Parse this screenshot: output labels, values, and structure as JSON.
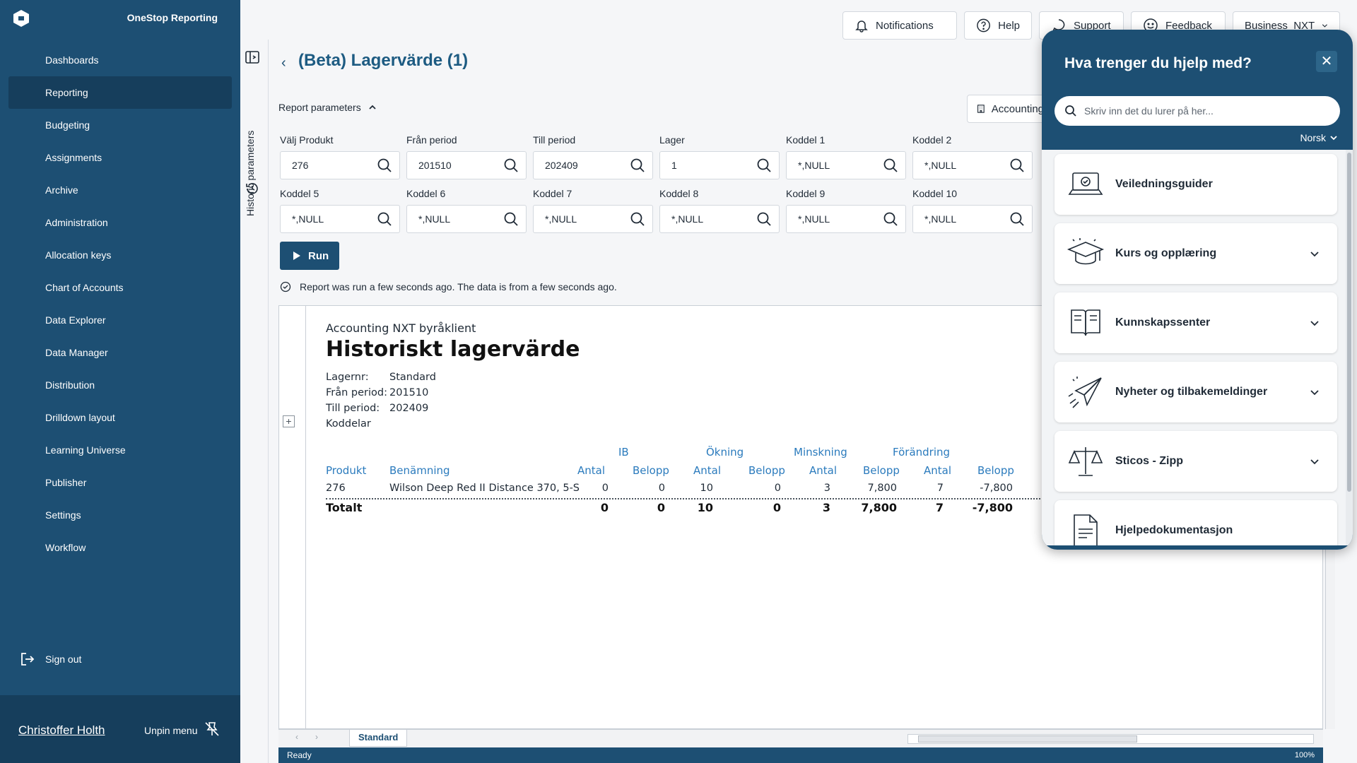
{
  "sidebar": {
    "brand": "OneStop Reporting",
    "items": [
      {
        "label": "Dashboards"
      },
      {
        "label": "Reporting"
      },
      {
        "label": "Budgeting"
      },
      {
        "label": "Assignments"
      },
      {
        "label": "Archive"
      },
      {
        "label": "Administration"
      },
      {
        "label": "Allocation keys"
      },
      {
        "label": "Chart of Accounts"
      },
      {
        "label": "Data Explorer"
      },
      {
        "label": "Data Manager"
      },
      {
        "label": "Distribution"
      },
      {
        "label": "Drilldown layout"
      },
      {
        "label": "Learning Universe"
      },
      {
        "label": "Publisher"
      },
      {
        "label": "Settings"
      },
      {
        "label": "Workflow"
      }
    ],
    "active_item": "Reporting",
    "sign_out": "Sign out",
    "user_name": "Christoffer Holth",
    "unpin_menu": "Unpin menu"
  },
  "side_panel": {
    "label": "Historic parameters"
  },
  "topbar": {
    "notifications": "Notifications",
    "help": "Help",
    "support": "Support",
    "feedback": "Feedback",
    "company": "Business_NXT"
  },
  "page": {
    "title": "(Beta) Lagervärde (1)",
    "report_parameters": "Report parameters",
    "accounting_button": "Accounting"
  },
  "params": [
    {
      "label": "Välj Produkt",
      "value": "276"
    },
    {
      "label": "Från period",
      "value": "201510"
    },
    {
      "label": "Till period",
      "value": "202409"
    },
    {
      "label": "Lager",
      "value": "1"
    },
    {
      "label": "Koddel 1",
      "value": "*,NULL"
    },
    {
      "label": "Koddel 2",
      "value": "*,NULL"
    },
    {
      "label": "Koddel 5",
      "value": "*,NULL"
    },
    {
      "label": "Koddel 6",
      "value": "*,NULL"
    },
    {
      "label": "Koddel 7",
      "value": "*,NULL"
    },
    {
      "label": "Koddel 8",
      "value": "*,NULL"
    },
    {
      "label": "Koddel 9",
      "value": "*,NULL"
    },
    {
      "label": "Koddel 10",
      "value": "*,NULL"
    }
  ],
  "run_button": "Run",
  "status_text": "Report was run a few seconds ago.  The data is from a few seconds ago.",
  "report": {
    "company": "Accounting NXT byråklient",
    "title": "Historiskt lagervärde",
    "meta": [
      {
        "key": "Lagernr:",
        "value": "Standard"
      },
      {
        "key": "Från period:",
        "value": "201510"
      },
      {
        "key": "Till period:",
        "value": "202409"
      },
      {
        "key": "Koddelar",
        "value": ""
      }
    ],
    "groups": [
      "IB",
      "Ökning",
      "Minskning",
      "Förändring"
    ],
    "columns": [
      "Produkt",
      "Benämning",
      "Antal",
      "Belopp",
      "Antal",
      "Belopp",
      "Antal",
      "Belopp",
      "Antal",
      "Belopp"
    ],
    "rows": [
      {
        "produkt": "276",
        "benamning": "Wilson Deep Red II Distance 370, 5-S",
        "values": [
          "0",
          "0",
          "10",
          "0",
          "3",
          "7,800",
          "7",
          "-7,800"
        ]
      }
    ],
    "total": {
      "label": "Totalt",
      "values": [
        "0",
        "0",
        "10",
        "0",
        "3",
        "7,800",
        "7",
        "-7,800"
      ]
    }
  },
  "sheet_tab": "Standard",
  "statusbar": {
    "state": "Ready",
    "zoom": "100%"
  },
  "help_panel": {
    "title": "Hva trenger du hjelp med?",
    "search_placeholder": "Skriv inn det du lurer på her...",
    "language": "Norsk",
    "items": [
      {
        "label": "Veiledningsguider",
        "icon": "laptop-icon",
        "expandable": false
      },
      {
        "label": "Kurs og opplæring",
        "icon": "graduation-cap-icon",
        "expandable": true
      },
      {
        "label": "Kunnskapssenter",
        "icon": "book-icon",
        "expandable": true
      },
      {
        "label": "Nyheter og tilbakemeldinger",
        "icon": "paper-plane-icon",
        "expandable": true
      },
      {
        "label": "Sticos - Zipp",
        "icon": "scales-icon",
        "expandable": true
      },
      {
        "label": "Hjelpedokumentasjon",
        "icon": "document-icon",
        "expandable": false
      }
    ]
  }
}
